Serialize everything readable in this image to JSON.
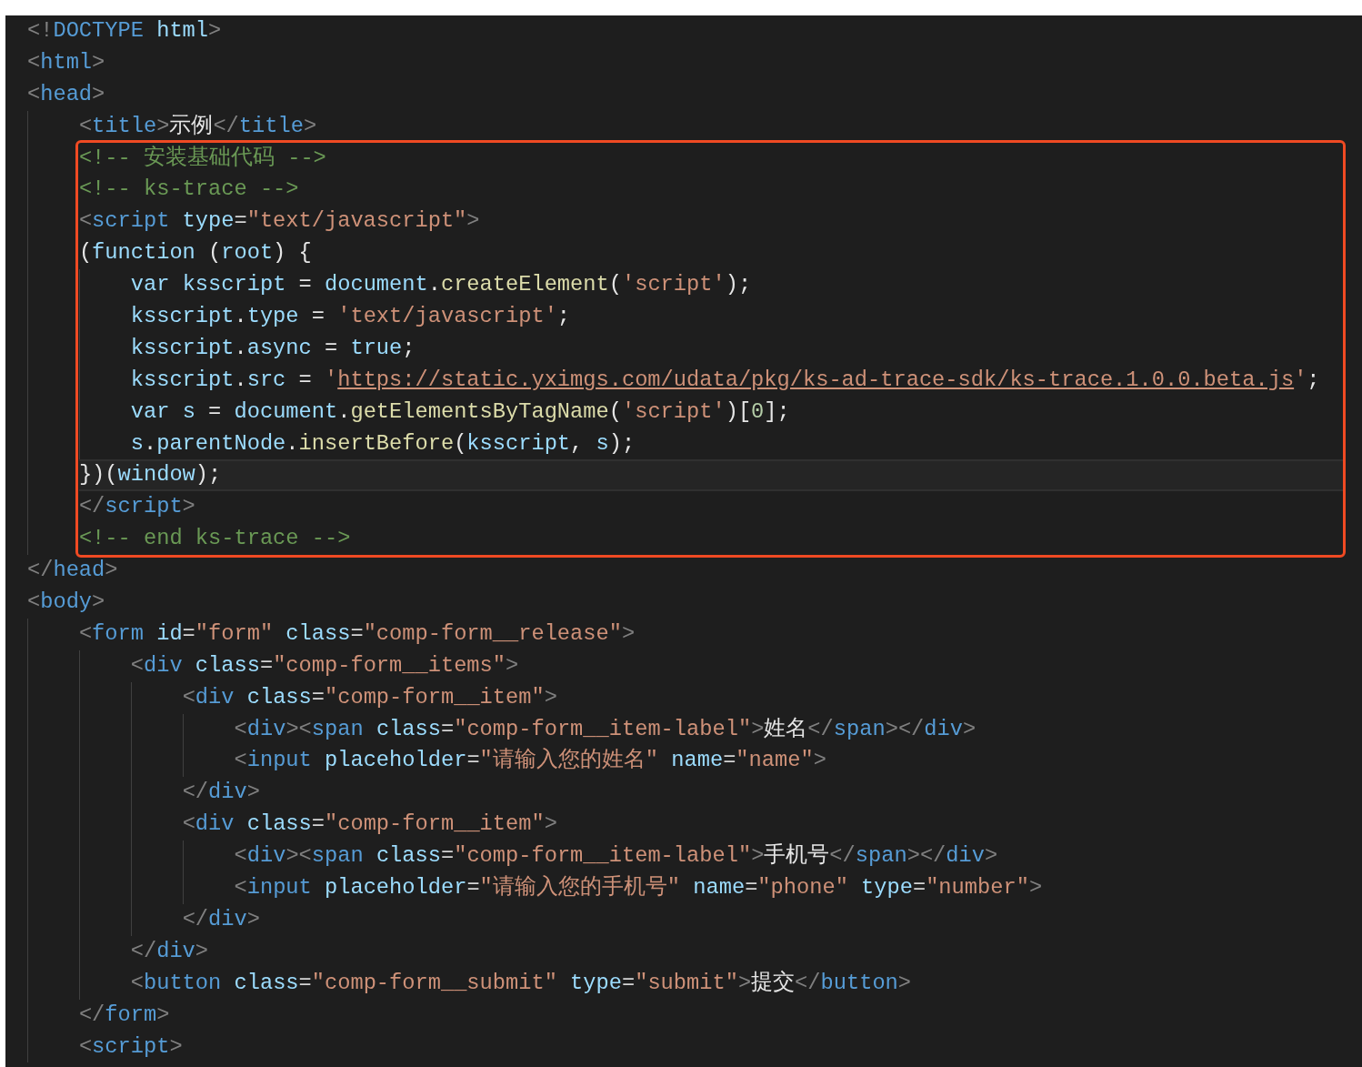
{
  "lines": [
    {
      "kind": "html",
      "text": "<!DOCTYPE html>"
    },
    {
      "kind": "html",
      "text": "<html>"
    },
    {
      "kind": "html",
      "text": "<head>",
      "children": [
        {
          "kind": "html",
          "text": "<title>示例</title>"
        },
        {
          "kind": "highlight",
          "children": [
            {
              "kind": "html",
              "text": "<!-- 安装基础代码 -->"
            },
            {
              "kind": "html",
              "text": "<!-- ks-trace -->"
            },
            {
              "kind": "html",
              "text": "<script type=\"text/javascript\">"
            },
            {
              "kind": "js",
              "text": "(function (root) {",
              "children": [
                {
                  "kind": "js",
                  "text": "var ksscript = document.createElement('script');"
                },
                {
                  "kind": "js",
                  "text": "ksscript.type = 'text/javascript';"
                },
                {
                  "kind": "js",
                  "text": "ksscript.async = true;"
                },
                {
                  "kind": "js",
                  "text": "ksscript.src = 'https://static.yximgs.com/udata/pkg/ks-ad-trace-sdk/ks-trace.1.0.0.beta.js';"
                },
                {
                  "kind": "js",
                  "text": "var s = document.getElementsByTagName('script')[0];"
                },
                {
                  "kind": "js",
                  "text": "s.parentNode.insertBefore(ksscript, s);"
                }
              ]
            },
            {
              "kind": "js",
              "text": "})(window);",
              "current": true
            },
            {
              "kind": "html",
              "text": "</script>"
            },
            {
              "kind": "html",
              "text": "<!-- end ks-trace -->"
            }
          ]
        }
      ]
    },
    {
      "kind": "html",
      "text": "</head>"
    },
    {
      "kind": "html",
      "text": "<body>",
      "children": [
        {
          "kind": "html",
          "text": "<form id=\"form\" class=\"comp-form__release\">",
          "children": [
            {
              "kind": "html",
              "text": "<div class=\"comp-form__items\">",
              "children": [
                {
                  "kind": "html",
                  "text": "<div class=\"comp-form__item\">",
                  "children": [
                    {
                      "kind": "html",
                      "text": "<div><span class=\"comp-form__item-label\">姓名</span></div>"
                    },
                    {
                      "kind": "html",
                      "text": "<input placeholder=\"请输入您的姓名\" name=\"name\">"
                    }
                  ]
                },
                {
                  "kind": "html",
                  "text": "</div>"
                },
                {
                  "kind": "html",
                  "text": "<div class=\"comp-form__item\">",
                  "children": [
                    {
                      "kind": "html",
                      "text": "<div><span class=\"comp-form__item-label\">手机号</span></div>"
                    },
                    {
                      "kind": "html",
                      "text": "<input placeholder=\"请输入您的手机号\" name=\"phone\" type=\"number\">"
                    }
                  ]
                },
                {
                  "kind": "html",
                  "text": "</div>"
                }
              ]
            },
            {
              "kind": "html",
              "text": "</div>"
            },
            {
              "kind": "html",
              "text": "<button class=\"comp-form__submit\" type=\"submit\">提交</button>"
            }
          ]
        },
        {
          "kind": "html",
          "text": "</form>"
        },
        {
          "kind": "html",
          "text": "<script>"
        }
      ]
    }
  ]
}
